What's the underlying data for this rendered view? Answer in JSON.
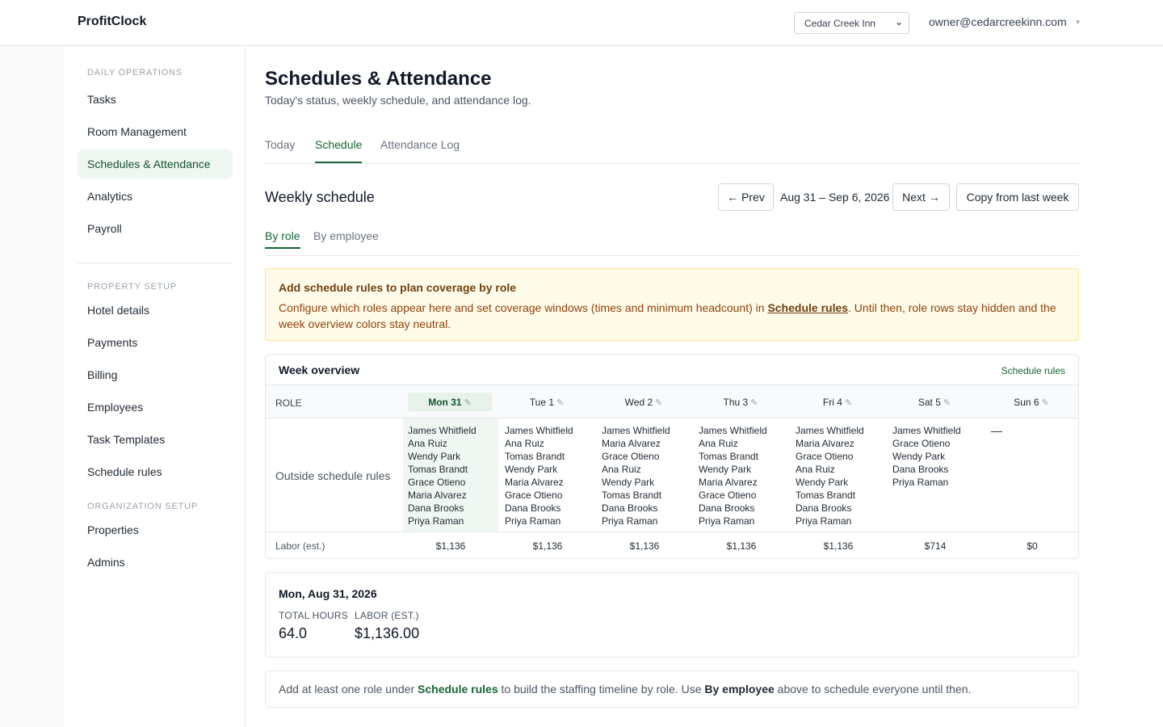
{
  "header": {
    "brand": "ProfitClock",
    "property_selected": "Cedar Creek Inn",
    "user_email": "owner@cedarcreekinn.com"
  },
  "sidebar": {
    "daily_title": "DAILY OPERATIONS",
    "daily_items": [
      "Tasks",
      "Room Management",
      "Schedules & Attendance",
      "Analytics",
      "Payroll"
    ],
    "property_title": "PROPERTY SETUP",
    "property_items": [
      "Hotel details",
      "Payments",
      "Billing",
      "Employees",
      "Task Templates",
      "Schedule rules"
    ],
    "org_title": "ORGANIZATION SETUP",
    "org_items": [
      "Properties",
      "Admins"
    ]
  },
  "page": {
    "title": "Schedules & Attendance",
    "subtitle": "Today's status, weekly schedule, and attendance log.",
    "tabs": [
      "Today",
      "Schedule",
      "Attendance Log"
    ],
    "active_tab": "Schedule"
  },
  "weekly": {
    "title": "Weekly schedule",
    "prev_label": "← Prev",
    "range": "Aug 31 – Sep 6, 2026",
    "next_label": "Next →",
    "copy_label": "Copy from last week",
    "subtabs": [
      "By role",
      "By employee"
    ],
    "active_subtab": "By role"
  },
  "notice": {
    "title": "Add schedule rules to plan coverage by role",
    "body_before": "Configure which roles appear here and set coverage windows (times and minimum headcount) in ",
    "link": "Schedule rules",
    "body_after": ". Until then, role rows stay hidden and the week overview colors stay neutral."
  },
  "overview": {
    "title": "Week overview",
    "link": "Schedule rules",
    "role_header": "ROLE",
    "row_label": "Outside schedule rules",
    "labor_label": "Labor (est.)",
    "days": [
      {
        "label": "Mon 31",
        "selected": true,
        "employees": [
          "James Whitfield",
          "Ana Ruiz",
          "Wendy Park",
          "Tomas Brandt",
          "Grace Otieno",
          "Maria Alvarez",
          "Dana Brooks",
          "Priya Raman"
        ],
        "labor": "$1,136"
      },
      {
        "label": "Tue 1",
        "selected": false,
        "employees": [
          "James Whitfield",
          "Ana Ruiz",
          "Tomas Brandt",
          "Wendy Park",
          "Maria Alvarez",
          "Grace Otieno",
          "Dana Brooks",
          "Priya Raman"
        ],
        "labor": "$1,136"
      },
      {
        "label": "Wed 2",
        "selected": false,
        "employees": [
          "James Whitfield",
          "Maria Alvarez",
          "Grace Otieno",
          "Ana Ruiz",
          "Wendy Park",
          "Tomas Brandt",
          "Dana Brooks",
          "Priya Raman"
        ],
        "labor": "$1,136"
      },
      {
        "label": "Thu 3",
        "selected": false,
        "employees": [
          "James Whitfield",
          "Ana Ruiz",
          "Tomas Brandt",
          "Wendy Park",
          "Maria Alvarez",
          "Grace Otieno",
          "Dana Brooks",
          "Priya Raman"
        ],
        "labor": "$1,136"
      },
      {
        "label": "Fri 4",
        "selected": false,
        "employees": [
          "James Whitfield",
          "Maria Alvarez",
          "Grace Otieno",
          "Ana Ruiz",
          "Wendy Park",
          "Tomas Brandt",
          "Dana Brooks",
          "Priya Raman"
        ],
        "labor": "$1,136"
      },
      {
        "label": "Sat 5",
        "selected": false,
        "employees": [
          "James Whitfield",
          "Grace Otieno",
          "Wendy Park",
          "Dana Brooks",
          "Priya Raman"
        ],
        "labor": "$714"
      },
      {
        "label": "Sun 6",
        "selected": false,
        "employees": [],
        "empty_marker": "—",
        "labor": "$0"
      }
    ]
  },
  "day_detail": {
    "title": "Mon, Aug 31, 2026",
    "hours_label": "TOTAL HOURS",
    "hours_value": "64.0",
    "labor_label": "LABOR (EST.)",
    "labor_value": "$1,136.00"
  },
  "tip": {
    "before": "Add at least one role under ",
    "link": "Schedule rules",
    "middle": " to build the staffing timeline by role. Use ",
    "bold": "By employee",
    "after": " above to schedule everyone until then."
  }
}
